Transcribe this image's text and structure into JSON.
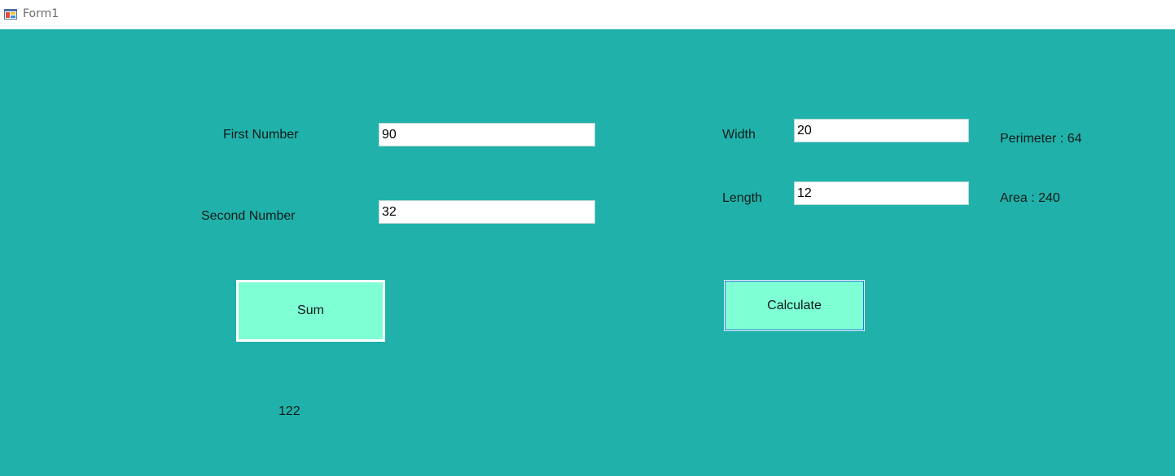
{
  "window": {
    "title": "Form1",
    "icon": "winforms-app-icon",
    "background_color": "#20b2aa"
  },
  "sum_section": {
    "first_label": "First Number",
    "first_value": "90",
    "second_label": "Second Number",
    "second_value": "32",
    "button_label": "Sum",
    "result": "122"
  },
  "rect_section": {
    "width_label": "Width",
    "width_value": "20",
    "length_label": "Length",
    "length_value": "12",
    "button_label": "Calculate",
    "perimeter_text": "Perimeter : 64",
    "area_text": "Area : 240"
  },
  "colors": {
    "client_background": "#20b2aa",
    "button_background": "#7fffd4"
  }
}
